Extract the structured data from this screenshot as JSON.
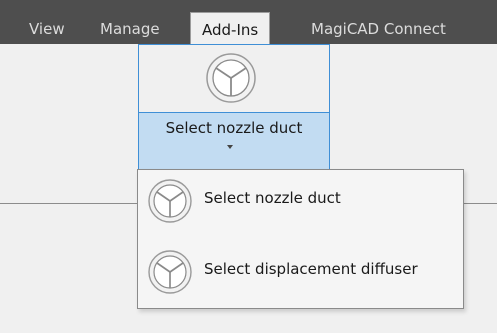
{
  "ribbon": {
    "tabs": [
      {
        "label": "View",
        "active": false
      },
      {
        "label": "Manage",
        "active": false
      },
      {
        "label": "Add-Ins",
        "active": true
      },
      {
        "label": "MagiCAD Connect",
        "active": false
      }
    ]
  },
  "split_button": {
    "label": "Select nozzle duct",
    "icon": "diffuser-icon"
  },
  "dropdown": {
    "items": [
      {
        "label": "Select nozzle duct",
        "icon": "diffuser-icon"
      },
      {
        "label": "Select displacement diffuser",
        "icon": "diffuser-icon"
      }
    ]
  },
  "colors": {
    "tab_bar": "#4e4e4e",
    "accent_border": "#3f8fd6",
    "accent_fill": "#c2dcf2",
    "background": "#f0f0f0"
  }
}
